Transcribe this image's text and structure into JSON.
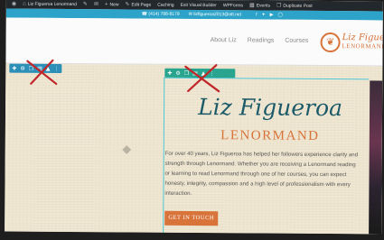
{
  "admin_bar": {
    "site_name": "Liz Figueroa Lenormand",
    "items": [
      "New",
      "Edit Page",
      "Caching",
      "Exit Visual Builder",
      "WPForms",
      "Events",
      "Duplicate Post"
    ]
  },
  "top_bar": {
    "phone": "(414) 788-8179",
    "email": "lizfigueroa2013@att.net",
    "socials": [
      "facebook-icon",
      "twitter-icon",
      "youtube-icon",
      "instagram-icon"
    ]
  },
  "nav": {
    "items": [
      "About Liz",
      "Readings",
      "Courses"
    ]
  },
  "logo": {
    "line1": "Liz Figueroa",
    "line2": "LENORMAND"
  },
  "hero": {
    "name": "Liz Figueroa",
    "subtitle": "LENORMAND",
    "bio": "For over 40 years, Liz Figueroa has helped her followers experience clarity and strength through Lenormand. Whether you are receiving a Lenormand reading or learning to read Lenormand through one of her courses, you can expect honesty, integrity, compassion and a high level of professionalism with every interaction.",
    "cta_label": "GET IN TOUCH"
  },
  "colors": {
    "accent": "#d8733a",
    "title": "#1c5a6a",
    "builder_row": "#2b8fb8",
    "builder_column": "#29a58f",
    "strike_mark": "#c0262a"
  }
}
